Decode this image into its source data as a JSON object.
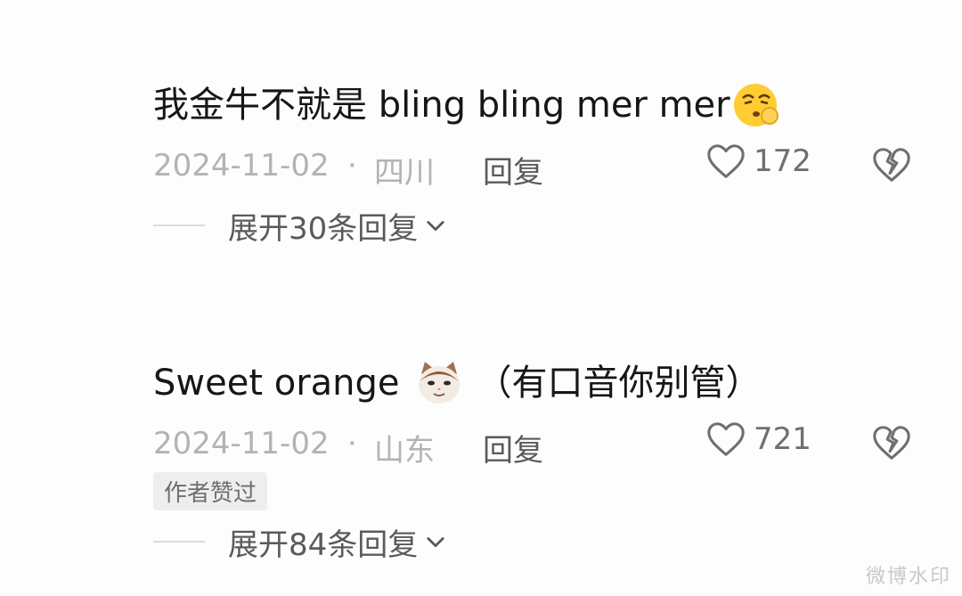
{
  "comments": [
    {
      "text": "我金牛不就是 bling bling mer mer",
      "emoji_icon": "shushing-face-emoji",
      "date": "2024-11-02",
      "separator": "·",
      "location": "四川",
      "reply_label": "回复",
      "likes": "172",
      "expand_label": "展开30条回复"
    },
    {
      "text_before": "Sweet orange",
      "emoji_icon": "cat-face-emoji",
      "text_after": "（有口音你别管）",
      "date": "2024-11-02",
      "separator": "·",
      "location": "山东",
      "reply_label": "回复",
      "likes": "721",
      "badge": "作者赞过",
      "expand_label": "展开84条回复"
    }
  ],
  "watermark": "微博水印",
  "colors": {
    "text": "#161616",
    "meta": "#b3b3b3",
    "action": "#5a5a5a",
    "badge_bg": "#eeeeee"
  }
}
